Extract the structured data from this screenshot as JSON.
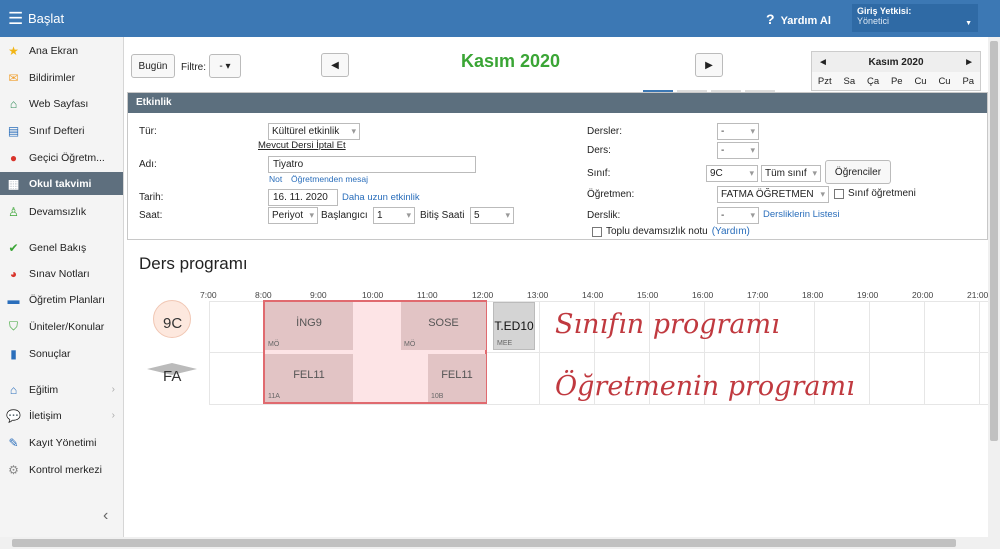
{
  "topbar": {
    "brand": "Başlat",
    "help_label": "Yardım Al",
    "auth_label": "Giriş Yetkisi:",
    "auth_value": "Yönetici"
  },
  "sidebar": {
    "items": [
      {
        "label": "Ana Ekran",
        "icon": "star-icon",
        "color": "#f2b515"
      },
      {
        "label": "Bildirimler",
        "icon": "envelope-icon",
        "color": "#f0a030"
      },
      {
        "label": "Web Sayfası",
        "icon": "home-icon",
        "color": "#2e8b57"
      },
      {
        "label": "Sınıf Defteri",
        "icon": "notebook-icon",
        "color": "#2a6ebb"
      },
      {
        "label": "Geçici Öğretm...",
        "icon": "person-icon",
        "color": "#d9342b"
      },
      {
        "label": "Okul takvimi",
        "icon": "calendar-icon",
        "color": "#ffffff"
      },
      {
        "label": "Devamsızlık",
        "icon": "user-outline-icon",
        "color": "#3aa535"
      },
      {
        "label": "Genel Bakış",
        "icon": "check-circle-icon",
        "color": "#3aa535"
      },
      {
        "label": "Sınav Notları",
        "icon": "gauge-icon",
        "color": "#d9342b"
      },
      {
        "label": "Öğretim Planları",
        "icon": "briefcase-icon",
        "color": "#2a6ebb"
      },
      {
        "label": "Üniteler/Konular",
        "icon": "shield-check-icon",
        "color": "#3aa535"
      },
      {
        "label": "Sonuçlar",
        "icon": "bar-chart-icon",
        "color": "#2a6ebb"
      },
      {
        "label": "Eğitim",
        "icon": "bank-icon",
        "color": "#2a6ebb"
      },
      {
        "label": "İletişim",
        "icon": "chat-icon",
        "color": "#d9342b"
      },
      {
        "label": "Kayıt Yönetimi",
        "icon": "pencil-icon",
        "color": "#2a6ebb"
      },
      {
        "label": "Kontrol merkezi",
        "icon": "gear-icon",
        "color": "#888888"
      }
    ]
  },
  "toolbar": {
    "today": "Bugün",
    "filter_label": "Filtre:",
    "filter_value": "-",
    "month_title": "Kasım 2020"
  },
  "mini_calendar": {
    "title": "Kasım 2020",
    "days": [
      "Pzt",
      "Sa",
      "Ça",
      "Pe",
      "Cu",
      "Cu",
      "Pa"
    ]
  },
  "form": {
    "header": "Etkinlik",
    "type_label": "Tür:",
    "type_value": "Kültürel etkinlik",
    "cancel_link": "Mevcut Dersi İptal Et",
    "name_label": "Adı:",
    "name_value": "Tiyatro",
    "note_link": "Not",
    "teacher_msg_link": "Öğretmenden mesaj",
    "date_label": "Tarih:",
    "date_value": "16. 11. 2020",
    "longer_link": "Daha uzun etkinlik",
    "time_label": "Saat:",
    "time_mode": "Periyot",
    "start_label": "Başlangıcı",
    "start_value": "1",
    "end_label": "Bitiş Saati",
    "end_value": "5",
    "lessons_label": "Dersler:",
    "lessons_value": "-",
    "lesson_label": "Ders:",
    "lesson_value": "-",
    "class_label": "Sınıf:",
    "class_value": "9C",
    "class_scope": "Tüm sınıf",
    "students_btn": "Öğrenciler",
    "teacher_label": "Öğretmen:",
    "teacher_value": "FATMA ÖĞRETMEN",
    "class_teacher_chk": "Sınıf öğretmeni",
    "room_label": "Derslik:",
    "room_value": "-",
    "rooms_link": "Dersliklerin Listesi",
    "bulk_chk": "Toplu devamsızlık notu",
    "help_link": "(Yardım)"
  },
  "schedule": {
    "title": "Ders programı",
    "hours": [
      "7:00",
      "8:00",
      "9:00",
      "10:00",
      "11:00",
      "12:00",
      "13:00",
      "14:00",
      "15:00",
      "16:00",
      "17:00",
      "18:00",
      "19:00",
      "20:00",
      "21:00"
    ],
    "rows": [
      {
        "label": "9C",
        "blocks": [
          {
            "name": "İNG9",
            "sub": "MÖ"
          },
          {
            "name": "SOSE",
            "sub": "MÖ"
          },
          {
            "name": "T.ED10",
            "sub": "MEE"
          }
        ]
      },
      {
        "label": "FA",
        "blocks": [
          {
            "name": "FEL11",
            "sub": "11A"
          },
          {
            "name": "FEL11",
            "sub": "10B"
          }
        ]
      }
    ],
    "annotation_class": "Sınıfın programı",
    "annotation_teacher": "Öğretmenin programı"
  }
}
